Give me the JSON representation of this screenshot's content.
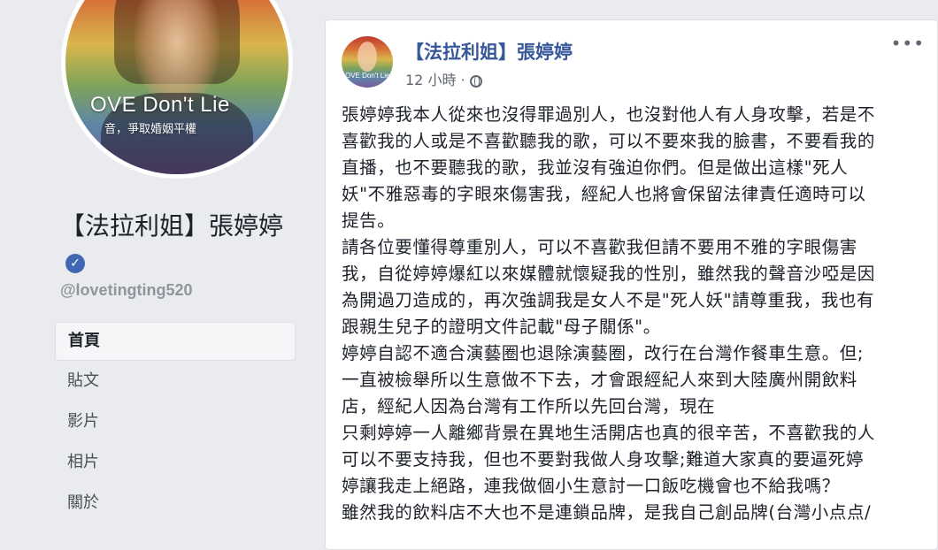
{
  "sidebar": {
    "avatar_caption": "OVE Don't Lie",
    "avatar_subcaption": "音，爭取婚姻平權",
    "page_name": "【法拉利姐】張婷婷",
    "handle": "@lovetingting520",
    "nav": [
      {
        "label": "首頁"
      },
      {
        "label": "貼文"
      },
      {
        "label": "影片"
      },
      {
        "label": "相片"
      },
      {
        "label": "關於"
      }
    ]
  },
  "post": {
    "avatar_caption": "OVE Don't Lie",
    "author": "【法拉利姐】張婷婷",
    "time": "12 小時",
    "more": "•••",
    "lines": [
      "張婷婷我本人從來也沒得罪過別人，也沒對他人有人身攻擊，若是不",
      "喜歡我的人或是不喜歡聽我的歌，可以不要來我的臉書，不要看我的",
      "直播，也不要聽我的歌，我並沒有強迫你們。但是做出這樣\"死人",
      "妖\"不雅惡毒的字眼來傷害我，經紀人也將會保留法律責任適時可以",
      "提告。",
      "請各位要懂得尊重別人，可以不喜歡我但請不要用不雅的字眼傷害",
      "我，自從婷婷爆紅以來媒體就懷疑我的性別，雖然我的聲音沙啞是因",
      "為開過刀造成的，再次強調我是女人不是\"死人妖\"請尊重我，我也有",
      "跟親生兒子的證明文件記載\"母子關係\"。",
      "婷婷自認不適合演藝圈也退除演藝圈，改行在台灣作餐車生意。但;",
      "一直被檢舉所以生意做不下去，才會跟經紀人來到大陸廣州開飲料",
      "店，經紀人因為台灣有工作所以先回台灣，現在",
      "只剩婷婷一人離鄉背景在異地生活開店也真的很辛苦，不喜歡我的人",
      "可以不要支持我，但也不要對我做人身攻擊;難道大家真的要逼死婷",
      "婷讓我走上絕路，連我做個小生意討一口飯吃機會也不給我嗎？",
      "雖然我的飲料店不大也不是連鎖品牌，是我自己創品牌(台灣小点点/"
    ]
  }
}
